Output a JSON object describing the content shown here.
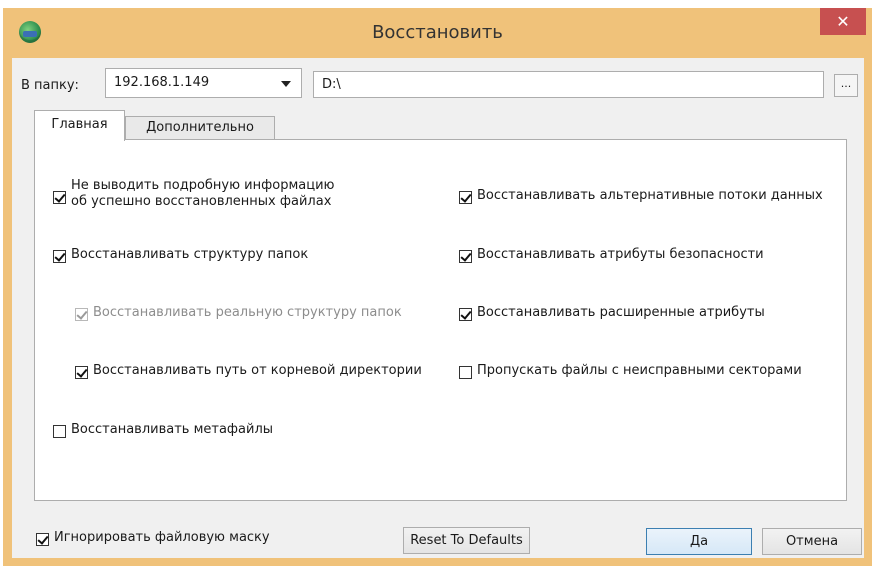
{
  "window": {
    "title": "Восстановить",
    "close_glyph": "✕",
    "app_icon": "restore-app-icon"
  },
  "destination": {
    "label": "В папку:",
    "host": "192.168.1.149",
    "path": "D:\\",
    "browse_label": "..."
  },
  "tabs": [
    {
      "label": "Главная",
      "active": true
    },
    {
      "label": "Дополнительно",
      "active": false
    }
  ],
  "options": {
    "no_detail_info": {
      "line1": "Не выводить подробную информацию",
      "line2": "об успешно восстановленных файлах",
      "checked": true,
      "enabled": true
    },
    "restore_folder_structure": {
      "label": "Восстанавливать структуру папок",
      "checked": true,
      "enabled": true
    },
    "restore_real_structure": {
      "label": "Восстанавливать реальную структуру папок",
      "checked": true,
      "enabled": false
    },
    "restore_root_path": {
      "label": "Восстанавливать путь от корневой директории",
      "checked": true,
      "enabled": true
    },
    "restore_metafiles": {
      "label": "Восстанавливать метафайлы",
      "checked": false,
      "enabled": true
    },
    "restore_alt_streams": {
      "label": "Восстанавливать альтернативные потоки данных",
      "checked": true,
      "enabled": true
    },
    "restore_security_attrs": {
      "label": "Восстанавливать атрибуты безопасности",
      "checked": true,
      "enabled": true
    },
    "restore_ext_attrs": {
      "label": "Восстанавливать расширенные атрибуты",
      "checked": true,
      "enabled": true
    },
    "skip_bad_sectors": {
      "label": "Пропускать файлы с неисправными секторами",
      "checked": false,
      "enabled": true
    }
  },
  "footer": {
    "ignore_mask": {
      "label": "Игнорировать файловую маску",
      "checked": true
    },
    "reset_label": "Reset To Defaults",
    "ok_label": "Да",
    "cancel_label": "Отмена"
  },
  "colors": {
    "title_bar": "#f0c27a",
    "close_button": "#c75050",
    "dialog_bg": "#f0f0f0"
  }
}
